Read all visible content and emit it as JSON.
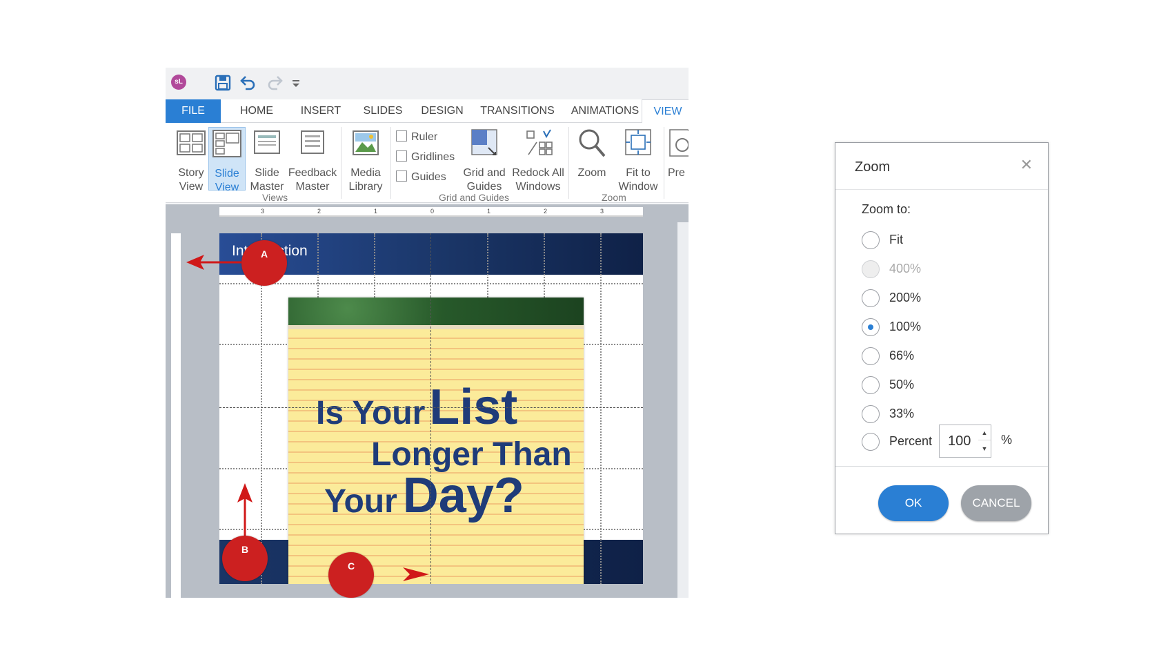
{
  "app": {
    "logo_text": "sL",
    "tabs": [
      "FILE",
      "HOME",
      "INSERT",
      "SLIDES",
      "DESIGN",
      "TRANSITIONS",
      "ANIMATIONS",
      "VIEW"
    ],
    "active_tab": "VIEW",
    "ribbon": {
      "story_view": [
        "Story",
        "View"
      ],
      "slide_view": [
        "Slide",
        "View"
      ],
      "slide_master": [
        "Slide",
        "Master"
      ],
      "feedback_master": [
        "Feedback",
        "Master"
      ],
      "media_library": [
        "Media",
        "Library"
      ],
      "ruler": "Ruler",
      "gridlines": "Gridlines",
      "guides": "Guides",
      "grid_and_guides": [
        "Grid and",
        "Guides"
      ],
      "redock": [
        "Redock All",
        "Windows"
      ],
      "zoom": "Zoom",
      "fit_to_window": [
        "Fit to",
        "Window"
      ],
      "pre": "Pre",
      "groups": [
        "Views",
        "Grid and Guides",
        "Zoom"
      ]
    },
    "ruler_ticks": [
      "3",
      "2",
      "1",
      "0",
      "1",
      "2",
      "3"
    ],
    "slide": {
      "title": "Introduction",
      "notepad": {
        "line1a": "Is Your",
        "line1b": "List",
        "line2": "Longer Than",
        "line3a": "Your",
        "line3b": "Day?"
      }
    }
  },
  "callouts": {
    "a": "A",
    "b": "B",
    "c": "C"
  },
  "zoom_dialog": {
    "title": "Zoom",
    "zoom_to_label": "Zoom to:",
    "options": [
      "Fit",
      "400%",
      "200%",
      "100%",
      "66%",
      "50%",
      "33%",
      "Percent"
    ],
    "selected": "100%",
    "percent_value": "100",
    "percent_sign": "%",
    "ok": "OK",
    "cancel": "CANCEL"
  },
  "colors": {
    "accent": "#2a7fd4",
    "callout": "#cc2020",
    "slide_navy": "#1a3566"
  }
}
